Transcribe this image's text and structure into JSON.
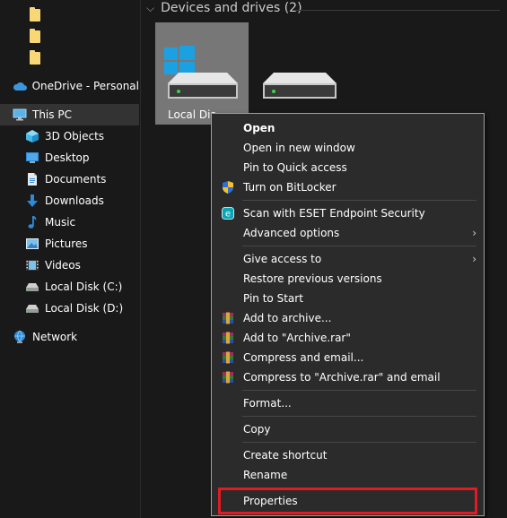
{
  "sidebar": {
    "onedrive": "OneDrive - Personal",
    "this_pc": "This PC",
    "items": [
      {
        "label": "3D Objects",
        "icon": "3d-objects-icon"
      },
      {
        "label": "Desktop",
        "icon": "desktop-icon"
      },
      {
        "label": "Documents",
        "icon": "documents-icon"
      },
      {
        "label": "Downloads",
        "icon": "downloads-icon"
      },
      {
        "label": "Music",
        "icon": "music-icon"
      },
      {
        "label": "Pictures",
        "icon": "pictures-icon"
      },
      {
        "label": "Videos",
        "icon": "videos-icon"
      },
      {
        "label": "Local Disk (C:)",
        "icon": "drive-icon"
      },
      {
        "label": "Local Disk (D:)",
        "icon": "drive-icon"
      }
    ],
    "network": "Network"
  },
  "main": {
    "group_header": "Devices and drives (2)",
    "drives": [
      {
        "label": "Local Dis"
      },
      {
        "label": ""
      }
    ]
  },
  "context_menu": {
    "items": [
      {
        "label": "Open"
      },
      {
        "label": "Open in new window"
      },
      {
        "label": "Pin to Quick access"
      },
      {
        "label": "Turn on BitLocker"
      },
      {
        "label": "Scan with ESET Endpoint Security"
      },
      {
        "label": "Advanced options"
      },
      {
        "label": "Give access to"
      },
      {
        "label": "Restore previous versions"
      },
      {
        "label": "Pin to Start"
      },
      {
        "label": "Add to archive..."
      },
      {
        "label": "Add to \"Archive.rar\""
      },
      {
        "label": "Compress and email..."
      },
      {
        "label": "Compress to \"Archive.rar\" and email"
      },
      {
        "label": "Format..."
      },
      {
        "label": "Copy"
      },
      {
        "label": "Create shortcut"
      },
      {
        "label": "Rename"
      },
      {
        "label": "Properties"
      }
    ]
  },
  "colors": {
    "background": "#191919",
    "menu_background": "#2b2b2b",
    "selection": "#777777",
    "highlight_box": "#e01b24",
    "windows_blue": "#1ba1e2"
  }
}
